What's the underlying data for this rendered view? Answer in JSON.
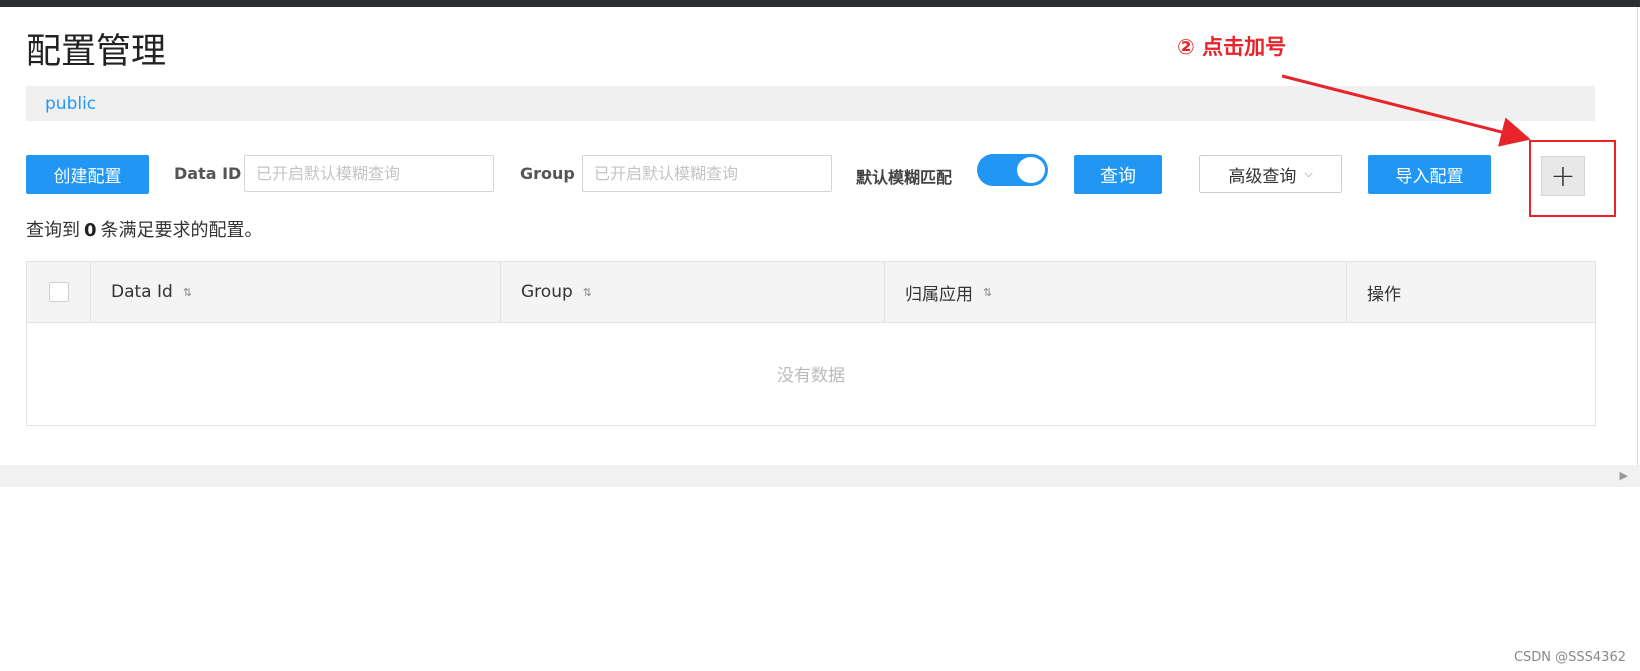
{
  "page": {
    "title": "配置管理",
    "namespace": "public"
  },
  "toolbar": {
    "create_button": "创建配置",
    "data_id_label": "Data ID",
    "data_id_placeholder": "已开启默认模糊查询",
    "group_label": "Group",
    "group_placeholder": "已开启默认模糊查询",
    "fuzzy_label": "默认模糊匹配",
    "fuzzy_enabled": true,
    "query_button": "查询",
    "advanced_query": "高级查询",
    "import_button": "导入配置",
    "add_button": "+"
  },
  "results": {
    "prefix": "查询到",
    "count": "0",
    "suffix": "条满足要求的配置。"
  },
  "table": {
    "columns": [
      "Data Id",
      "Group",
      "归属应用",
      "操作"
    ],
    "empty_text": "没有数据"
  },
  "annotation": {
    "text": "② 点击加号",
    "color": "#e8232a"
  },
  "watermark": "CSDN @SSS4362",
  "colors": {
    "primary": "#2196f3",
    "link": "#2497f5"
  },
  "icons": {
    "sort": "sort-icon",
    "chevron": "chevron-down-icon",
    "scroll": "scroll-right-icon"
  }
}
